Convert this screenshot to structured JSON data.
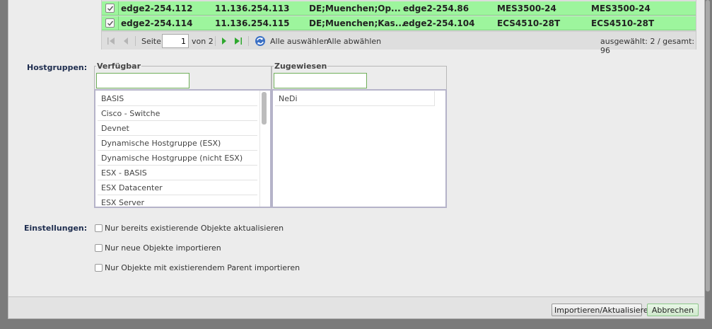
{
  "grid": {
    "rows": [
      {
        "checked": true,
        "cells": [
          "edge2-254.112",
          "11.136.254.113",
          "DE;Muenchen;Op...",
          "edge2-254.86",
          "MES3500-24",
          "MES3500-24"
        ]
      },
      {
        "checked": true,
        "cells": [
          "edge2-254.114",
          "11.136.254.115",
          "DE;Muenchen;Kas...",
          "edge2-254.104",
          "ECS4510-28T",
          "ECS4510-28T"
        ]
      }
    ],
    "pager": {
      "page_label": "Seite",
      "page_value": "1",
      "of_label": "von 2",
      "select_all": "Alle auswählen",
      "deselect_all": "Alle abwählen",
      "summary": "ausgewählt: 2 / gesamt: 96"
    }
  },
  "hostgroups": {
    "label": "Hostgruppen:",
    "available": {
      "legend": "Verfügbar",
      "filter_value": "",
      "items": [
        "BASIS",
        "Cisco - Switche",
        "Devnet",
        "Dynamische Hostgruppe (ESX)",
        "Dynamische Hostgruppe (nicht ESX)",
        "ESX - BASIS",
        "ESX Datacenter",
        "ESX Server"
      ]
    },
    "assigned": {
      "legend": "Zugewiesen",
      "filter_value": "",
      "items": [
        "NeDi"
      ]
    }
  },
  "settings": {
    "label": "Einstellungen:",
    "options": [
      {
        "label": "Nur bereits existierende Objekte aktualisieren",
        "checked": false
      },
      {
        "label": "Nur neue Objekte importieren",
        "checked": false
      },
      {
        "label": "Nur Objekte mit existierendem Parent importieren",
        "checked": false
      }
    ]
  },
  "footer": {
    "import_button": "Importieren/Aktualisieren",
    "cancel_button": "Abbrechen"
  },
  "colors": {
    "row_selected": "#9df59d",
    "accent_green": "#2ea82e",
    "label_blue": "#1e2d4f"
  }
}
